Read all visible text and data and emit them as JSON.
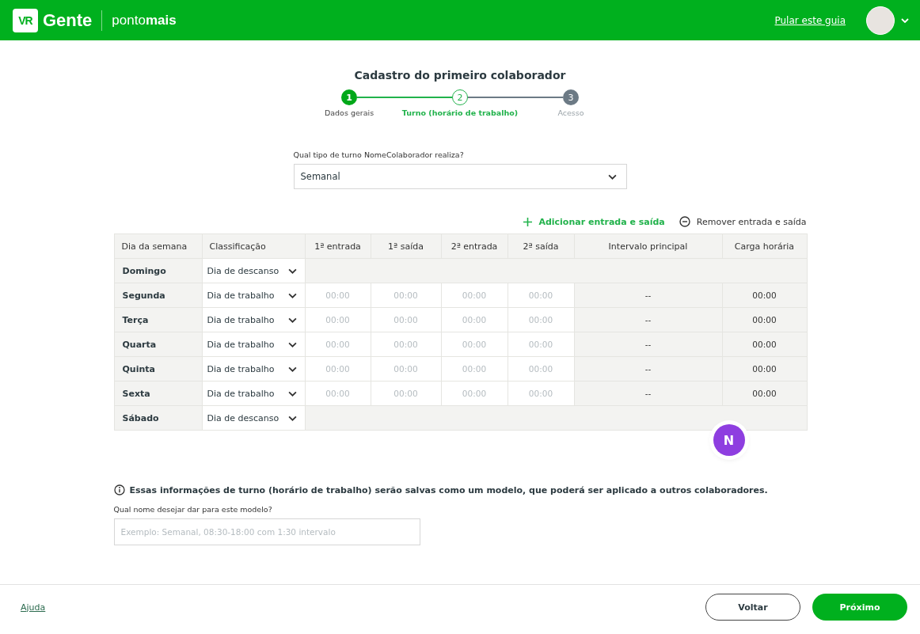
{
  "header": {
    "logo_mark": "VR",
    "logo_name": "Gente",
    "product": "ponto**mais**",
    "skip_link": "Pular este guia"
  },
  "title": "Cadastro do primeiro colaborador",
  "steps": [
    {
      "number": "1",
      "label": "Dados gerais",
      "done": true,
      "selected": false
    },
    {
      "number": "2",
      "label": "Turno (horário de trabalho)",
      "done": false,
      "selected": true
    },
    {
      "number": "3",
      "label": "Acesso",
      "done": false,
      "selected": false
    }
  ],
  "shift_type": {
    "label": "Qual tipo de turno NomeColaborador realiza?",
    "value": "Semanal"
  },
  "actions": {
    "add": "Adicionar entrada e saída",
    "remove": "Remover entrada e saída"
  },
  "table": {
    "columns": [
      "Dia da semana",
      "Classificação",
      "1ª entrada",
      "1ª saída",
      "2ª entrada",
      "2ª saída",
      "Intervalo principal",
      "Carga horária"
    ],
    "rows": [
      {
        "day": "Domingo",
        "classification": "Dia de descanso",
        "kind": "rest"
      },
      {
        "day": "Segunda",
        "classification": "Dia de trabalho",
        "kind": "work",
        "times": [
          {
            "placeholder": "00:00"
          },
          {
            "placeholder": "00:00"
          },
          {
            "placeholder": "00:00"
          },
          {
            "placeholder": "00:00"
          }
        ],
        "interval": "--",
        "load": "00:00"
      },
      {
        "day": "Terça",
        "classification": "Dia de trabalho",
        "kind": "work",
        "times": [
          {
            "placeholder": "00:00"
          },
          {
            "placeholder": "00:00"
          },
          {
            "placeholder": "00:00"
          },
          {
            "placeholder": "00:00"
          }
        ],
        "interval": "--",
        "load": "00:00"
      },
      {
        "day": "Quarta",
        "classification": "Dia de trabalho",
        "kind": "work",
        "times": [
          {
            "placeholder": "00:00"
          },
          {
            "placeholder": "00:00"
          },
          {
            "placeholder": "00:00"
          },
          {
            "placeholder": "00:00"
          }
        ],
        "interval": "--",
        "load": "00:00"
      },
      {
        "day": "Quinta",
        "classification": "Dia de trabalho",
        "kind": "work",
        "times": [
          {
            "placeholder": "00:00"
          },
          {
            "placeholder": "00:00"
          },
          {
            "placeholder": "00:00"
          },
          {
            "placeholder": "00:00"
          }
        ],
        "interval": "--",
        "load": "00:00"
      },
      {
        "day": "Sexta",
        "classification": "Dia de trabalho",
        "kind": "work",
        "times": [
          {
            "placeholder": "00:00"
          },
          {
            "placeholder": "00:00"
          },
          {
            "placeholder": "00:00"
          },
          {
            "placeholder": "00:00"
          }
        ],
        "interval": "--",
        "load": "00:00"
      },
      {
        "day": "Sábado",
        "classification": "Dia de descanso",
        "kind": "rest"
      }
    ]
  },
  "chat_badge": "N",
  "info": "Essas informações de turno (horário de trabalho) serão salvas como um modelo, que poderá ser aplicado a outros colaboradores.",
  "model_name": {
    "label": "Qual nome desejar dar para este modelo?",
    "placeholder": "Exemplo: Semanal, 08:30-18:00 com 1:30 intervalo"
  },
  "footer": {
    "help": "Ajuda",
    "back": "Voltar",
    "next": "Próximo"
  }
}
